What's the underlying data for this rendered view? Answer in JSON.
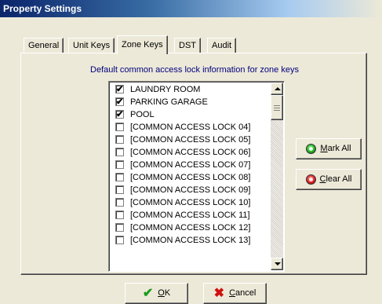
{
  "window": {
    "title": "Property Settings"
  },
  "tabs": [
    {
      "label": "General",
      "active": false
    },
    {
      "label": "Unit Keys",
      "active": false
    },
    {
      "label": "Zone Keys",
      "active": true
    },
    {
      "label": "DST",
      "active": false
    },
    {
      "label": "Audit",
      "active": false
    }
  ],
  "panel": {
    "caption": "Default common access lock information for zone keys",
    "items": [
      {
        "label": "LAUNDRY ROOM",
        "checked": true
      },
      {
        "label": "PARKING GARAGE",
        "checked": true
      },
      {
        "label": "POOL",
        "checked": true
      },
      {
        "label": "[COMMON ACCESS LOCK 04]",
        "checked": false
      },
      {
        "label": "[COMMON ACCESS LOCK 05]",
        "checked": false
      },
      {
        "label": "[COMMON ACCESS LOCK 06]",
        "checked": false
      },
      {
        "label": "[COMMON ACCESS LOCK 07]",
        "checked": false
      },
      {
        "label": "[COMMON ACCESS LOCK 08]",
        "checked": false
      },
      {
        "label": "[COMMON ACCESS LOCK 09]",
        "checked": false
      },
      {
        "label": "[COMMON ACCESS LOCK 10]",
        "checked": false
      },
      {
        "label": "[COMMON ACCESS LOCK 11]",
        "checked": false
      },
      {
        "label": "[COMMON ACCESS LOCK 12]",
        "checked": false
      },
      {
        "label": "[COMMON ACCESS LOCK 13]",
        "checked": false
      }
    ],
    "mark_all_label": "Mark All",
    "clear_all_label": "Clear All",
    "check_glyph": "✔"
  },
  "footer": {
    "ok_label": "OK",
    "cancel_label": "Cancel",
    "ok_icon": "green-checkmark-icon",
    "cancel_icon": "red-x-icon"
  }
}
